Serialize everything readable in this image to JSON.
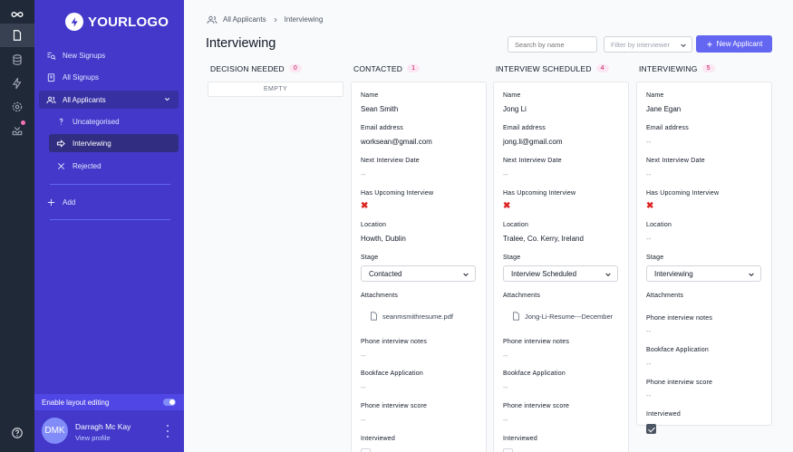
{
  "sidebar": {
    "logo": "YOURLOGO",
    "items": [
      {
        "label": "New Signups",
        "icon": "search-list-icon"
      },
      {
        "label": "All Signups",
        "icon": "clipboard-icon"
      },
      {
        "label": "All Applicants",
        "icon": "users-icon"
      },
      {
        "label": "Uncategorised",
        "icon": "question-icon"
      },
      {
        "label": "Interviewing",
        "icon": "arrow-right-icon"
      },
      {
        "label": "Rejected",
        "icon": "close-icon"
      },
      {
        "label": "Add",
        "icon": "plus-icon"
      }
    ],
    "layout_toggle": "Enable layout editing",
    "profile": {
      "initials": "DMK",
      "name": "Darragh Mc Kay",
      "link": "View profile"
    }
  },
  "header": {
    "breadcrumb": [
      "All Applicants",
      "Interviewing"
    ],
    "title": "Interviewing",
    "search_placeholder": "Search by name",
    "filter_placeholder": "Filter by interviewer",
    "new_button": "New Applicant"
  },
  "columns": [
    {
      "title": "DECISION NEEDED",
      "count": "0",
      "empty": "EMPTY"
    },
    {
      "title": "CONTACTED",
      "count": "1"
    },
    {
      "title": "INTERVIEW SCHEDULED",
      "count": "4"
    },
    {
      "title": "INTERVIEWING",
      "count": "5"
    }
  ],
  "labels": {
    "name": "Name",
    "email": "Email address",
    "next_date": "Next Interview Date",
    "upcoming": "Has Upcoming Interview",
    "location": "Location",
    "stage": "Stage",
    "attachments": "Attachments",
    "notes": "Phone interview notes",
    "bookface": "Bookface Application",
    "score": "Phone interview score",
    "interviewed": "Interviewed"
  },
  "cards": [
    {
      "name": "Sean Smith",
      "email": "worksean@gmail.com",
      "next_date": "--",
      "upcoming": "✖",
      "location": "Howth, Dublin",
      "stage": "Contacted",
      "attachment": "seanmsmithresume.pdf",
      "notes": "--",
      "bookface": "--",
      "score": "--"
    },
    {
      "name": "Jong Li",
      "email": "jong.li@gmail.com",
      "next_date": "--",
      "upcoming": "✖",
      "location": "Tralee, Co. Kerry, Ireland",
      "stage": "Interview Scheduled",
      "attachment": "Jong-Li-Resume---December",
      "notes": "--",
      "bookface": "--",
      "score": "--"
    },
    {
      "name": "Jane Egan",
      "email": "--",
      "next_date": "--",
      "upcoming": "✖",
      "location": "--",
      "stage": "Interviewing",
      "notes": "--",
      "bookface": "--",
      "score": "--",
      "interviewed": true
    }
  ],
  "colors": {
    "accent": "#6366f1",
    "sidebar": "#4338ca",
    "rail": "#1f2937",
    "reject": "#dc2626"
  }
}
